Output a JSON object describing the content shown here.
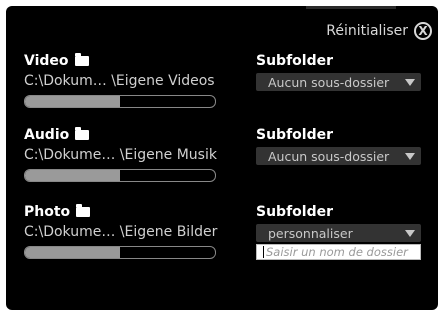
{
  "header": {
    "reset_label": "Réinitialiser",
    "close_glyph": "X"
  },
  "rows": [
    {
      "label": "Video",
      "path": "C:\\Dokum… \\Eigene Videos",
      "progress": 0.5,
      "subfolder_label": "Subfolder",
      "dropdown_value": "Aucun sous-dossier"
    },
    {
      "label": "Audio",
      "path": "C:\\Dokume… \\Eigene Musik",
      "progress": 0.5,
      "subfolder_label": "Subfolder",
      "dropdown_value": "Aucun sous-dossier"
    },
    {
      "label": "Photo",
      "path": "C:\\Dokume… \\Eigene Bilder",
      "progress": 0.5,
      "subfolder_label": "Subfolder",
      "dropdown_value": "personnaliser",
      "input_placeholder": "Saisir un nom de dossier"
    }
  ],
  "icons": {
    "folder": "folder-icon",
    "caret": "chevron-down-icon",
    "close": "close-icon"
  },
  "colors": {
    "panel_bg": "#000000",
    "text": "#ffffff",
    "dropdown_bg": "#333333",
    "progress_fill": "#9a9a9a"
  }
}
